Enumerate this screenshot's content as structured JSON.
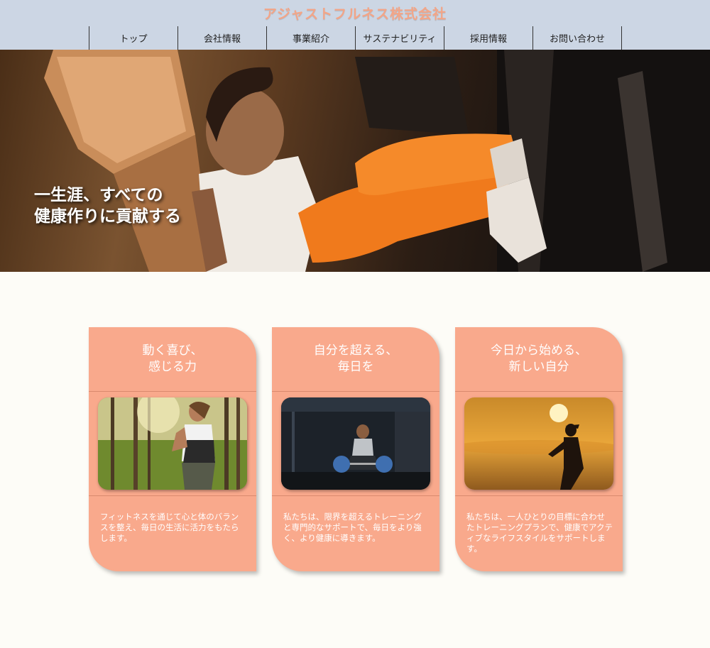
{
  "header": {
    "brand": "アジャストフルネス株式会社",
    "nav": [
      {
        "label": "トップ"
      },
      {
        "label": "会社情報"
      },
      {
        "label": "事業紹介"
      },
      {
        "label": "サステナビリティ"
      },
      {
        "label": "採用情報"
      },
      {
        "label": "お問い合わせ"
      }
    ]
  },
  "hero": {
    "tagline_line1": "一生涯、すべての",
    "tagline_line2": "健康作りに貢献する"
  },
  "cards": [
    {
      "title": "動く喜び、\n感じる力",
      "text": "フィットネスを通じて心と体のバランスを整え、毎日の生活に活力をもたらします。"
    },
    {
      "title": "自分を超える、\n毎日を",
      "text": "私たちは、限界を超えるトレーニングと専門的なサポートで、毎日をより強く、より健康に導きます。"
    },
    {
      "title": "今日から始める、\n新しい自分",
      "text": "私たちは、一人ひとりの目標に合わせたトレーニングプランで、健康でアクティブなライフスタイルをサポートします。"
    }
  ],
  "colors": {
    "header_bg": "#ccd6e4",
    "brand": "#f3a587",
    "card_bg": "#f9a98c",
    "page_bg": "#fdfcf7"
  }
}
